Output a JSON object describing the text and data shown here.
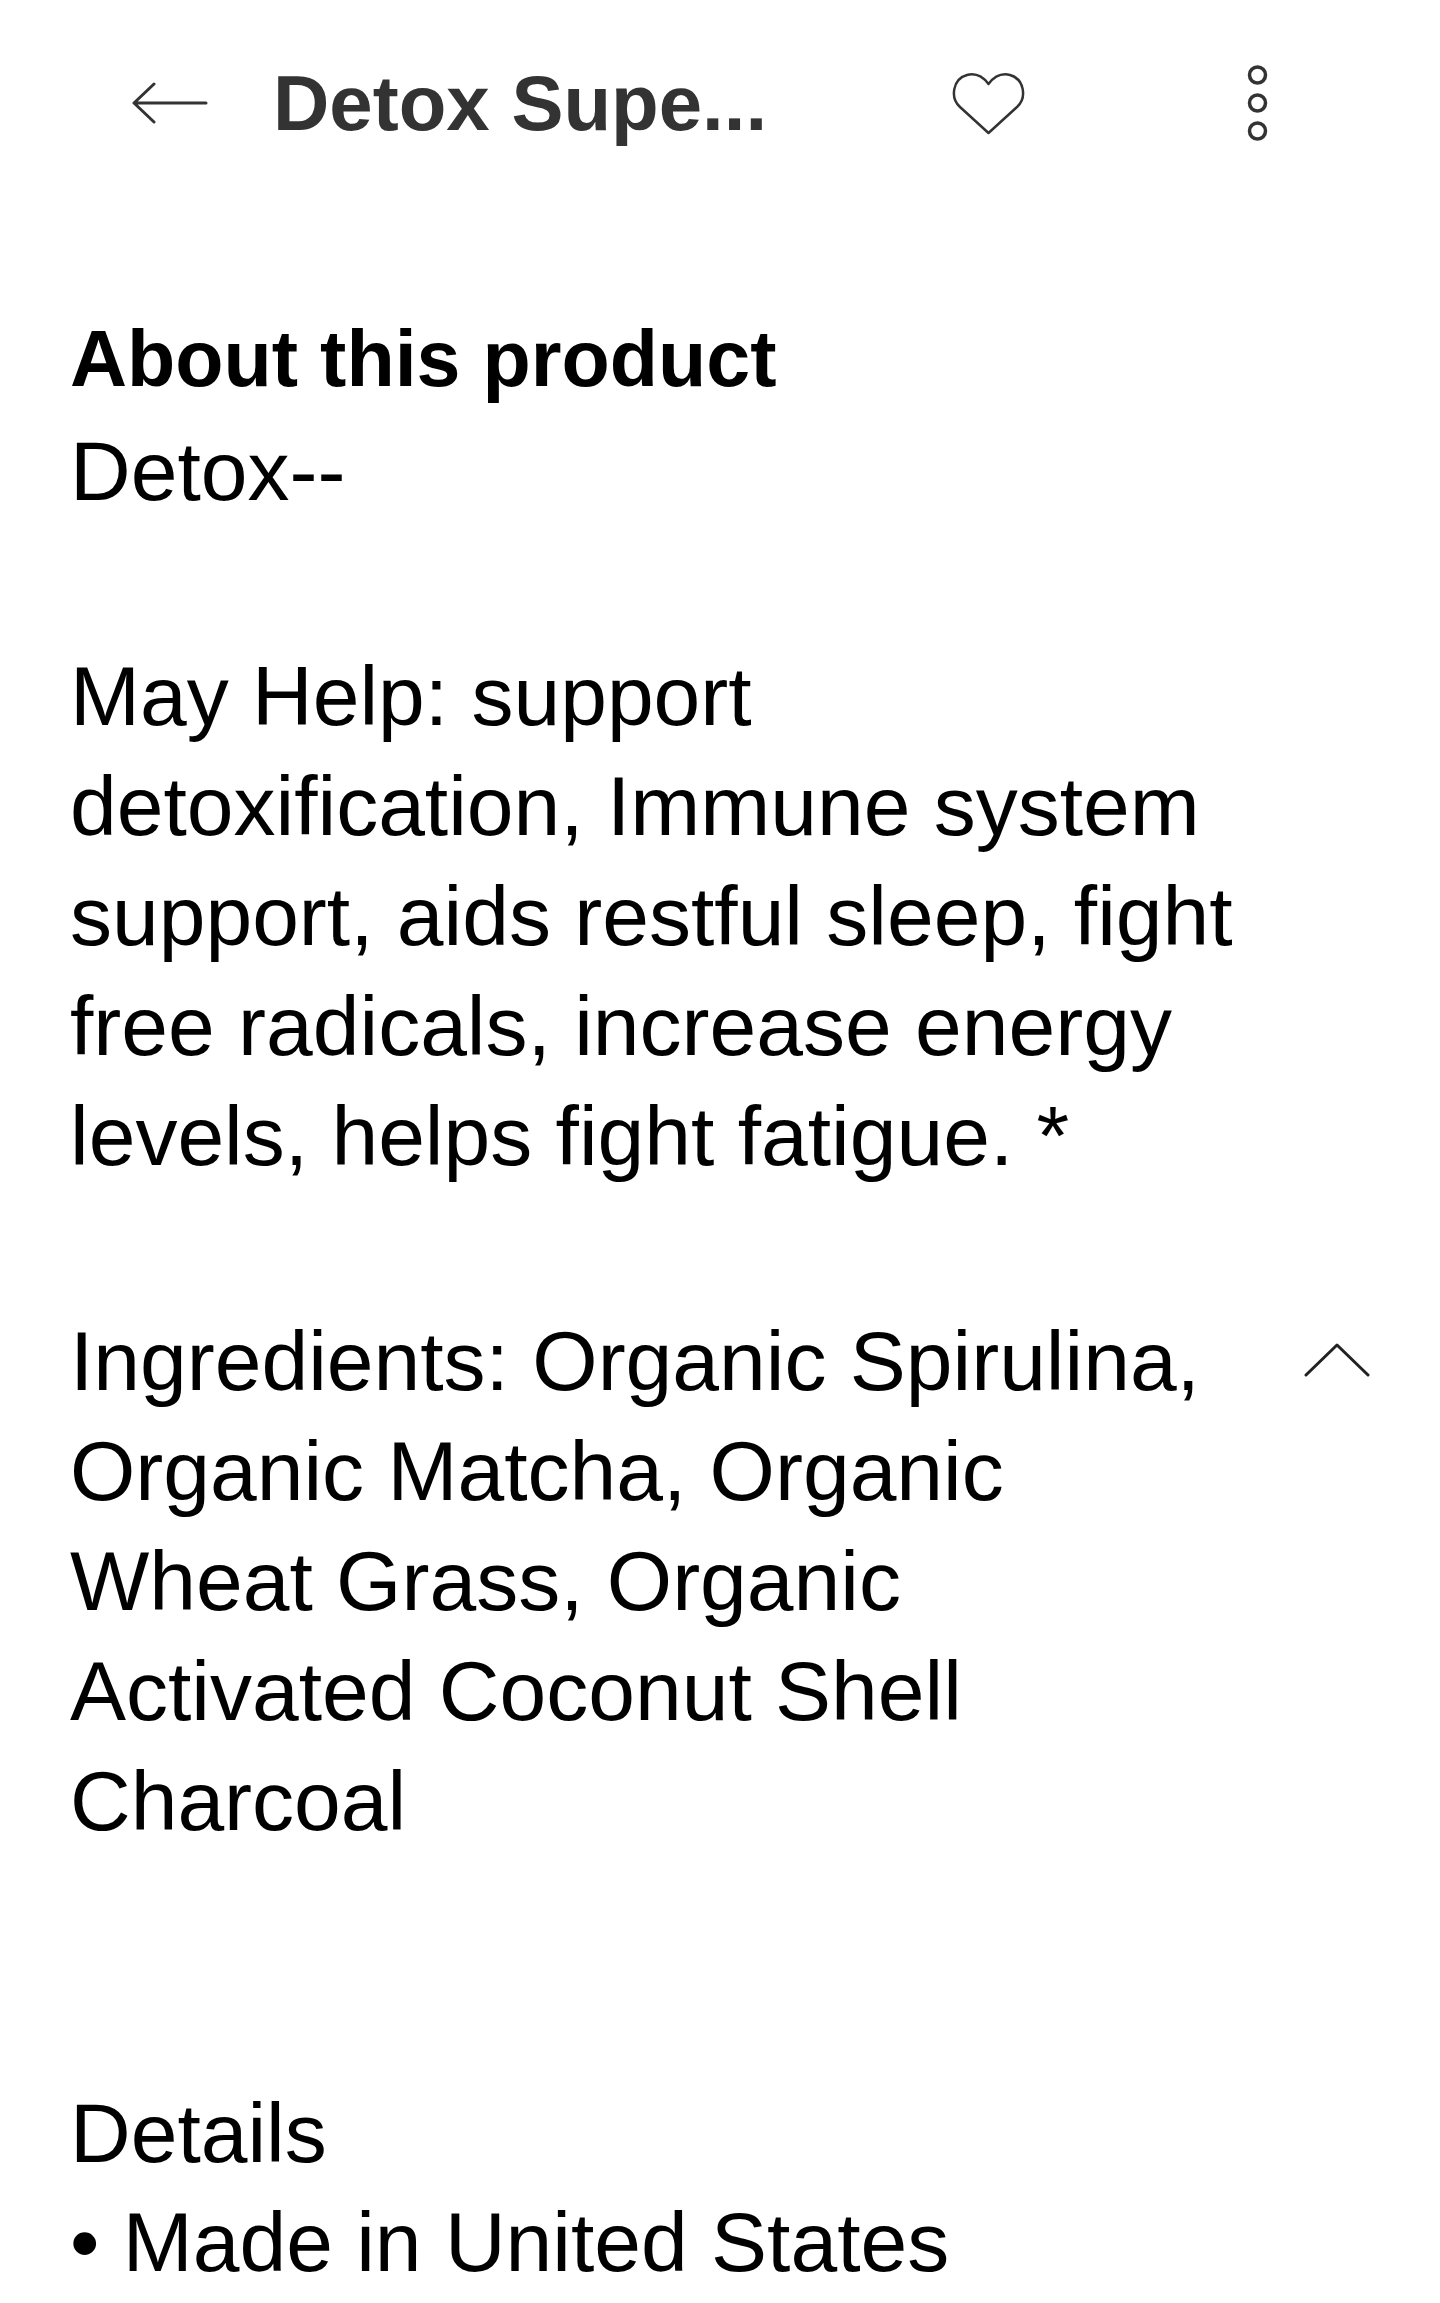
{
  "top_bar": {
    "title": "Detox Supe...",
    "favorite": false
  },
  "about": {
    "heading": "About this product",
    "paragraphs": [
      "Detox--",
      "May Help: support detoxification, Immune system support, aids restful sleep, fight free radicals, increase energy levels, helps fight fatigue. *"
    ]
  },
  "ingredients": {
    "text": "Ingredients: Organic Spirulina, Organic Matcha, Organic Wheat Grass, Organic Activated Coconut Shell Charcoal",
    "expanded": true
  },
  "details": {
    "heading": "Details",
    "items": [
      "• Made in United States"
    ]
  }
}
